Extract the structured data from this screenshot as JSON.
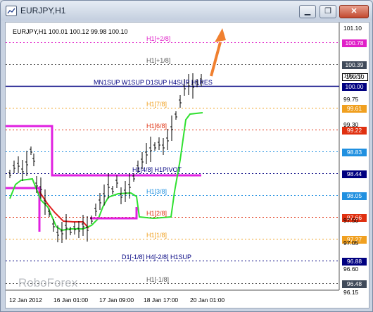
{
  "window": {
    "title": "EURJPY,H1",
    "minimize": "▁",
    "restore": "❐",
    "close": "✕"
  },
  "chart": {
    "ohlc_line": "EURJPY,H1  100.01 100.12 99.98 100.10",
    "watermark": "RoboForex",
    "levels": [
      {
        "label": "H1[+2/8]",
        "color": "#e020c8",
        "box": "100.78",
        "box_color": "#e020c8"
      },
      {
        "label": "H1[+1/8]",
        "color": "#555555",
        "box": "100.39",
        "box_color": "#404a5a"
      },
      {
        "label": "MN1SUP W1SUP D1SUP H4SUP H1RES",
        "color": "#000080",
        "box": "100.00",
        "box_color": "#000080"
      },
      {
        "label": "H1[7/8]",
        "color": "#f0a020",
        "box": "99.61",
        "box_color": "#f0a020"
      },
      {
        "label": "H1[6/8]",
        "color": "#e03010",
        "box": "99.22",
        "box_color": "#e03010"
      },
      {
        "label": "",
        "color": "#2090e0",
        "box": "98.83",
        "box_color": "#2090e0"
      },
      {
        "label": "H1[4/8] H1PIVOT",
        "color": "#000080",
        "box": "98.44",
        "box_color": "#000080"
      },
      {
        "label": "H1[3/8]",
        "color": "#2090e0",
        "box": "98.05",
        "box_color": "#2090e0"
      },
      {
        "label": "H1[2/8]",
        "color": "#e03010",
        "box": "97.66",
        "box_color": "#e03010"
      },
      {
        "label": "H1[1/8]",
        "color": "#f0a020",
        "box": "97.27",
        "box_color": "#f0a020"
      },
      {
        "label": "D1[-1/8] H4[-2/8] H1SUP",
        "color": "#000080",
        "box": "96.88",
        "box_color": "#000080"
      },
      {
        "label": "H1[-1/8]",
        "color": "#555555",
        "box": "96.48",
        "box_color": "#404a5a"
      }
    ],
    "current_price_box": "100.10",
    "y_ticks": [
      "101.10",
      "100.20",
      "99.75",
      "99.30",
      "97.50",
      "97.05",
      "96.60",
      "96.15"
    ],
    "x_ticks": [
      "12 Jan 2012",
      "16 Jan 01:00",
      "17 Jan 09:00",
      "18 Jan 17:00",
      "20 Jan 01:00"
    ]
  }
}
